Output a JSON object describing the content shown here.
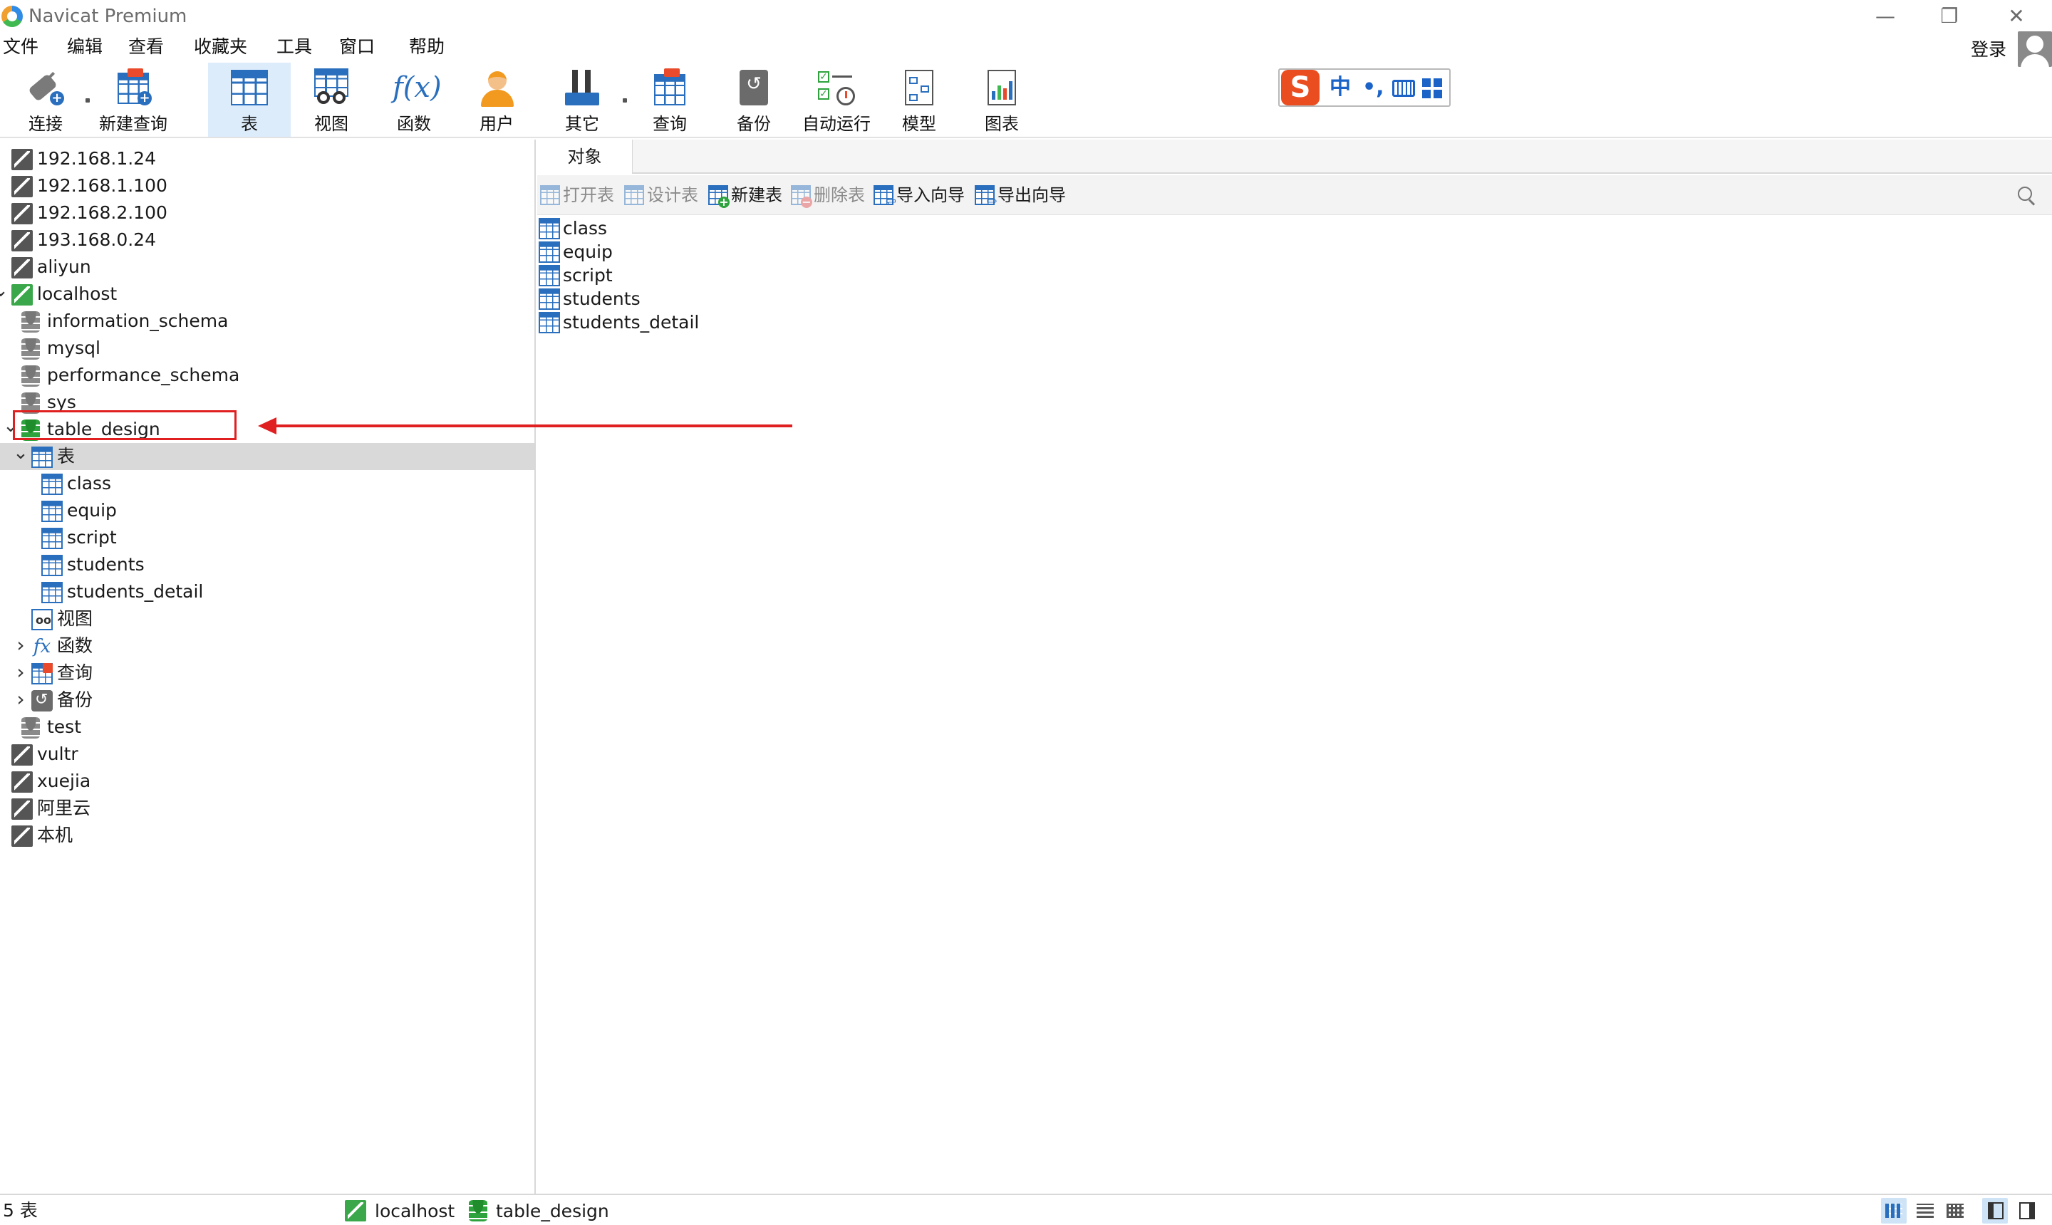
{
  "window": {
    "title": "Navicat Premium",
    "controls": {
      "minimize": "—",
      "maximize": "❐",
      "close": "✕"
    }
  },
  "menu": {
    "items": [
      "文件",
      "编辑",
      "查看",
      "收藏夹",
      "工具",
      "窗口",
      "帮助"
    ],
    "login": "登录"
  },
  "toolbar": {
    "items": [
      {
        "label": "连接",
        "icon": "plug-icon"
      },
      {
        "label": "新建查询",
        "icon": "new-query-icon"
      },
      {
        "label": "表",
        "icon": "table-icon",
        "active": true
      },
      {
        "label": "视图",
        "icon": "view-icon"
      },
      {
        "label": "函数",
        "icon": "function-icon",
        "glyph": "f(x)"
      },
      {
        "label": "用户",
        "icon": "user-icon"
      },
      {
        "label": "其它",
        "icon": "tools-icon"
      },
      {
        "label": "查询",
        "icon": "query-icon"
      },
      {
        "label": "备份",
        "icon": "backup-icon"
      },
      {
        "label": "自动运行",
        "icon": "schedule-icon"
      },
      {
        "label": "模型",
        "icon": "model-icon"
      },
      {
        "label": "图表",
        "icon": "chart-icon"
      }
    ]
  },
  "ime": {
    "logo": "S",
    "mode": "中",
    "punct": "•,"
  },
  "tree": {
    "items": [
      {
        "label": "192.168.1.24",
        "type": "connection"
      },
      {
        "label": "192.168.1.100",
        "type": "connection"
      },
      {
        "label": "192.168.2.100",
        "type": "connection"
      },
      {
        "label": "193.168.0.24",
        "type": "connection"
      },
      {
        "label": "aliyun",
        "type": "connection"
      },
      {
        "label": "localhost",
        "type": "connection",
        "expanded": true,
        "open": true
      },
      {
        "label": "information_schema",
        "type": "database"
      },
      {
        "label": "mysql",
        "type": "database"
      },
      {
        "label": "performance_schema",
        "type": "database"
      },
      {
        "label": "sys",
        "type": "database"
      },
      {
        "label": "table_design",
        "type": "database",
        "expanded": true,
        "open": true
      },
      {
        "label": "表",
        "type": "tables-folder",
        "expanded": true,
        "selected": true
      },
      {
        "label": "class",
        "type": "table"
      },
      {
        "label": "equip",
        "type": "table"
      },
      {
        "label": "script",
        "type": "table"
      },
      {
        "label": "students",
        "type": "table"
      },
      {
        "label": "students_detail",
        "type": "table"
      },
      {
        "label": "视图",
        "type": "views-folder"
      },
      {
        "label": "函数",
        "type": "functions-folder",
        "collapsed": true
      },
      {
        "label": "查询",
        "type": "queries-folder",
        "collapsed": true
      },
      {
        "label": "备份",
        "type": "backups-folder",
        "collapsed": true
      },
      {
        "label": "test",
        "type": "database"
      },
      {
        "label": "vultr",
        "type": "connection"
      },
      {
        "label": "xuejia",
        "type": "connection"
      },
      {
        "label": "阿里云",
        "type": "connection"
      },
      {
        "label": "本机",
        "type": "connection"
      }
    ]
  },
  "right": {
    "tab": "对象",
    "actions": [
      {
        "label": "打开表",
        "enabled": false
      },
      {
        "label": "设计表",
        "enabled": false
      },
      {
        "label": "新建表",
        "enabled": true
      },
      {
        "label": "删除表",
        "enabled": false
      },
      {
        "label": "导入向导",
        "enabled": true
      },
      {
        "label": "导出向导",
        "enabled": true
      }
    ],
    "objects": [
      "class",
      "equip",
      "script",
      "students",
      "students_detail"
    ]
  },
  "status": {
    "count": "5 表",
    "connection": "localhost",
    "database": "table_design"
  },
  "colors": {
    "accent": "#2a6fbd",
    "active_tool_bg": "#dcecfb",
    "db_open": "#2ea23c",
    "annotation_red": "#e02020"
  }
}
